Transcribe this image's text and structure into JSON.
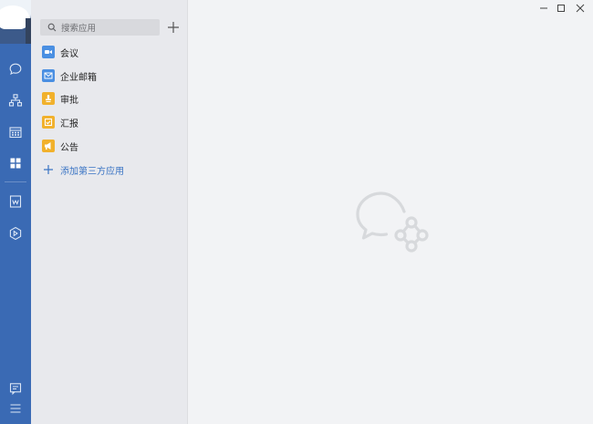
{
  "window": {
    "controls": [
      "minimize",
      "maximize",
      "close"
    ]
  },
  "rail": {
    "icons": [
      {
        "name": "chat-icon",
        "active": false
      },
      {
        "name": "org-chart-icon",
        "active": false
      },
      {
        "name": "calendar-icon",
        "active": false
      },
      {
        "name": "apps-grid-icon",
        "active": true
      },
      {
        "name": "document-icon",
        "active": false
      },
      {
        "name": "cube-icon",
        "active": false
      },
      {
        "name": "feedback-icon",
        "active": false
      },
      {
        "name": "menu-icon",
        "active": false
      }
    ],
    "bg_color": "#3a6ab4"
  },
  "search": {
    "placeholder": "搜索应用"
  },
  "apps": [
    {
      "label": "会议",
      "icon": "meeting-icon",
      "color": "#4a8fe2"
    },
    {
      "label": "企业邮箱",
      "icon": "mail-icon",
      "color": "#4a8fe2"
    },
    {
      "label": "审批",
      "icon": "approval-icon",
      "color": "#f1b12c"
    },
    {
      "label": "汇报",
      "icon": "report-icon",
      "color": "#f1b12c"
    },
    {
      "label": "公告",
      "icon": "announcement-icon",
      "color": "#f1b12c"
    }
  ],
  "add_app": {
    "label": "添加第三方应用",
    "color": "#3a74c4"
  },
  "main": {
    "logo": "wecom-logo-icon"
  }
}
